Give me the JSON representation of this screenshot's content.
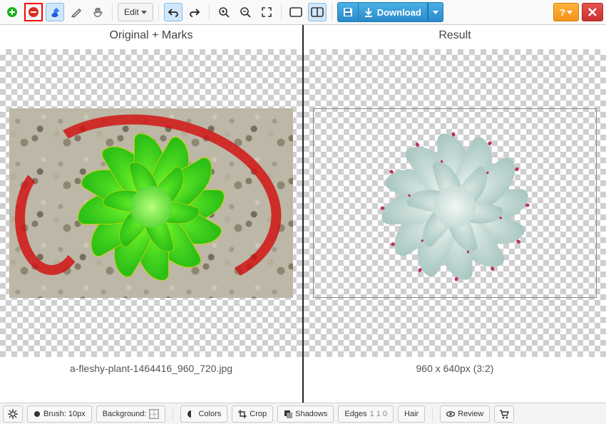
{
  "toolbar": {
    "edit_label": "Edit",
    "download_label": "Download",
    "help_label": "?"
  },
  "panes": {
    "left_title": "Original + Marks",
    "right_title": "Result",
    "filename": "a-fleshy-plant-1464416_960_720.jpg",
    "dimensions": "960 x 640px (3:2)"
  },
  "bottombar": {
    "brush": "Brush: 10px",
    "background": "Background:",
    "colors": "Colors",
    "crop": "Crop",
    "shadows": "Shadows",
    "edges": "Edges",
    "edges_vals": "1  1  0",
    "hair": "Hair",
    "review": "Review"
  }
}
